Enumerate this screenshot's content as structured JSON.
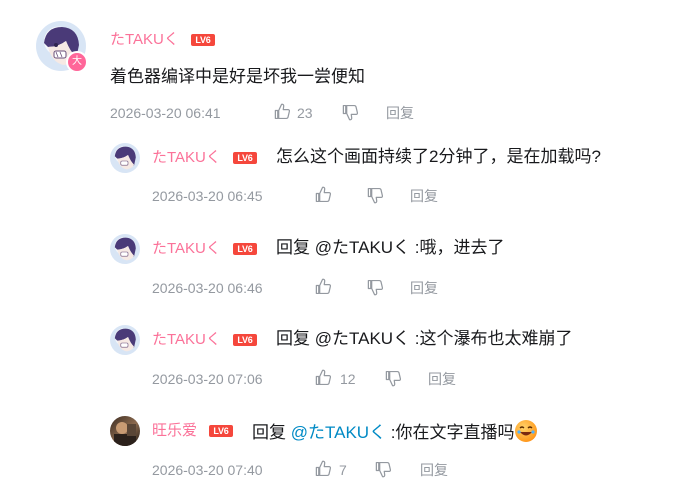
{
  "colors": {
    "username": "#fb7299",
    "level_badge": "#f5473c",
    "meta": "#9499a0",
    "mention": "#008ac5"
  },
  "main_comment": {
    "username": "たTAKUく",
    "level": "LV6",
    "badge": "大",
    "text": "着色器编译中是好是坏我一尝便知",
    "time": "2026-03-20 06:41",
    "likes": "23",
    "reply_label": "回复"
  },
  "replies": [
    {
      "username": "たTAKUく",
      "level": "LV6",
      "text": "怎么这个画面持续了2分钟了，是在加载吗?",
      "time": "2026-03-20 06:45",
      "likes": "",
      "reply_label": "回复"
    },
    {
      "username": "たTAKUく",
      "level": "LV6",
      "prefix": "回复 @たTAKUく :",
      "text": "哦，进去了",
      "time": "2026-03-20 06:46",
      "likes": "",
      "reply_label": "回复"
    },
    {
      "username": "たTAKUく",
      "level": "LV6",
      "prefix": "回复 @たTAKUく :",
      "text": "这个瀑布也太难崩了",
      "time": "2026-03-20 07:06",
      "likes": "12",
      "reply_label": "回复"
    },
    {
      "username": "旺乐爱",
      "level": "LV6",
      "prefix": "回复 ",
      "mention": "@たTAKUく",
      "text": " :你在文字直播吗",
      "emoji": "laughing-crying-emoji",
      "time": "2026-03-20 07:40",
      "likes": "7",
      "reply_label": "回复"
    }
  ]
}
